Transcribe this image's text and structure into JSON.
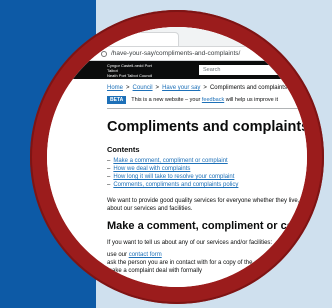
{
  "browser": {
    "tab_title": "...",
    "address": "/have-your-say/compliments-and-complaints/"
  },
  "site": {
    "logo_line1": "Cyngor Castell-nedd Port Talbot",
    "logo_line2": "Neath Port Talbot Council",
    "search_placeholder": "Search"
  },
  "breadcrumb": {
    "items": [
      "Home",
      "Council",
      "Have your say"
    ],
    "current": "Compliments and complaints",
    "separator": ">"
  },
  "beta": {
    "tag": "BETA",
    "text_before": "This is a new website – your",
    "link": "feedback",
    "text_after": "will help us improve it"
  },
  "page_title": "Compliments and complaints",
  "contents": {
    "title": "Contents",
    "dash": "–",
    "items": [
      "Make a comment, compliment or complaint",
      "How we deal with complaints",
      "How long it will take to resolve your complaint",
      "Comments, compliments and complaints policy"
    ]
  },
  "intro": "We want to provide good quality services for everyone whether they live, work in or think about our services and facilities.",
  "section_heading": "Make a comment, compliment or complaint",
  "section_para": "If you want to tell us about any of our services and/or facilities:",
  "steps": [
    {
      "before": "use our ",
      "link": "contact form",
      "after": ""
    },
    {
      "before": "ask the person you are in contact with for a copy of the ",
      "link": "co",
      "after": ""
    },
    {
      "before": "make a complaint deal with formally",
      "link": "",
      "after": ""
    },
    {
      "before": "",
      "link": "",
      "after": ""
    }
  ],
  "colors": {
    "background_blue": "#0d5aa6",
    "panel_light": "#cfe0ee",
    "ring_red": "#9b1c1c",
    "link_blue": "#1d70b8"
  }
}
